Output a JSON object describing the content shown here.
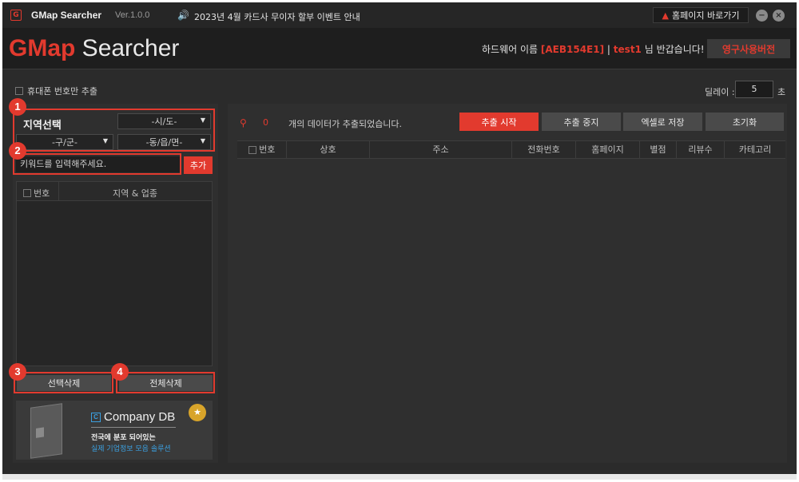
{
  "titlebar": {
    "app_name": "GMap Searcher",
    "version": "Ver.1.0.0",
    "notice_text": "2023년 4월 카드사 무이자 할부 이벤트 안내",
    "home_button": "홈페이지 바로가기",
    "logo_letter": "G"
  },
  "header": {
    "brand_red": "GMap",
    "brand_white": " Searcher",
    "hw_prefix": "하드웨어 이름",
    "hw_id": "[AEB154E1]",
    "separator": "|",
    "user_name": "test1",
    "greeting": "님 반갑습니다!",
    "perm_button": "영구사용버전"
  },
  "options": {
    "phone_only_label": "휴대폰 번호만 추출",
    "delay_label": "딜레이 :",
    "delay_value": "5",
    "delay_unit": "초"
  },
  "left": {
    "region_title": "지역선택",
    "sido": "-시/도-",
    "gugun": "-구/군-",
    "dong": "-동/읍/면-",
    "keyword_placeholder": "키워드를 입력해주세요.",
    "add_button": "추가",
    "table_headers": [
      "번호",
      "지역 & 업종"
    ],
    "delete_selected": "선택삭제",
    "delete_all": "전체삭제",
    "badges": [
      "1",
      "2",
      "3",
      "4"
    ]
  },
  "ad": {
    "title": "Company DB",
    "line1": "전국에 분포 되어있는",
    "line2": "실제 기업정보 모음 솔루션"
  },
  "right": {
    "count": "0",
    "count_text": "개의 데이터가 추출되었습니다.",
    "buttons": {
      "start": "추출 시작",
      "stop": "추출 중지",
      "excel": "엑셀로 저장",
      "reset": "초기화"
    },
    "columns": [
      "번호",
      "상호",
      "주소",
      "전화번호",
      "홈페이지",
      "별점",
      "리뷰수",
      "카테고리"
    ]
  },
  "colors": {
    "accent": "#e23a2e",
    "panel": "#2f2f2f",
    "background": "#2b2b2b"
  }
}
